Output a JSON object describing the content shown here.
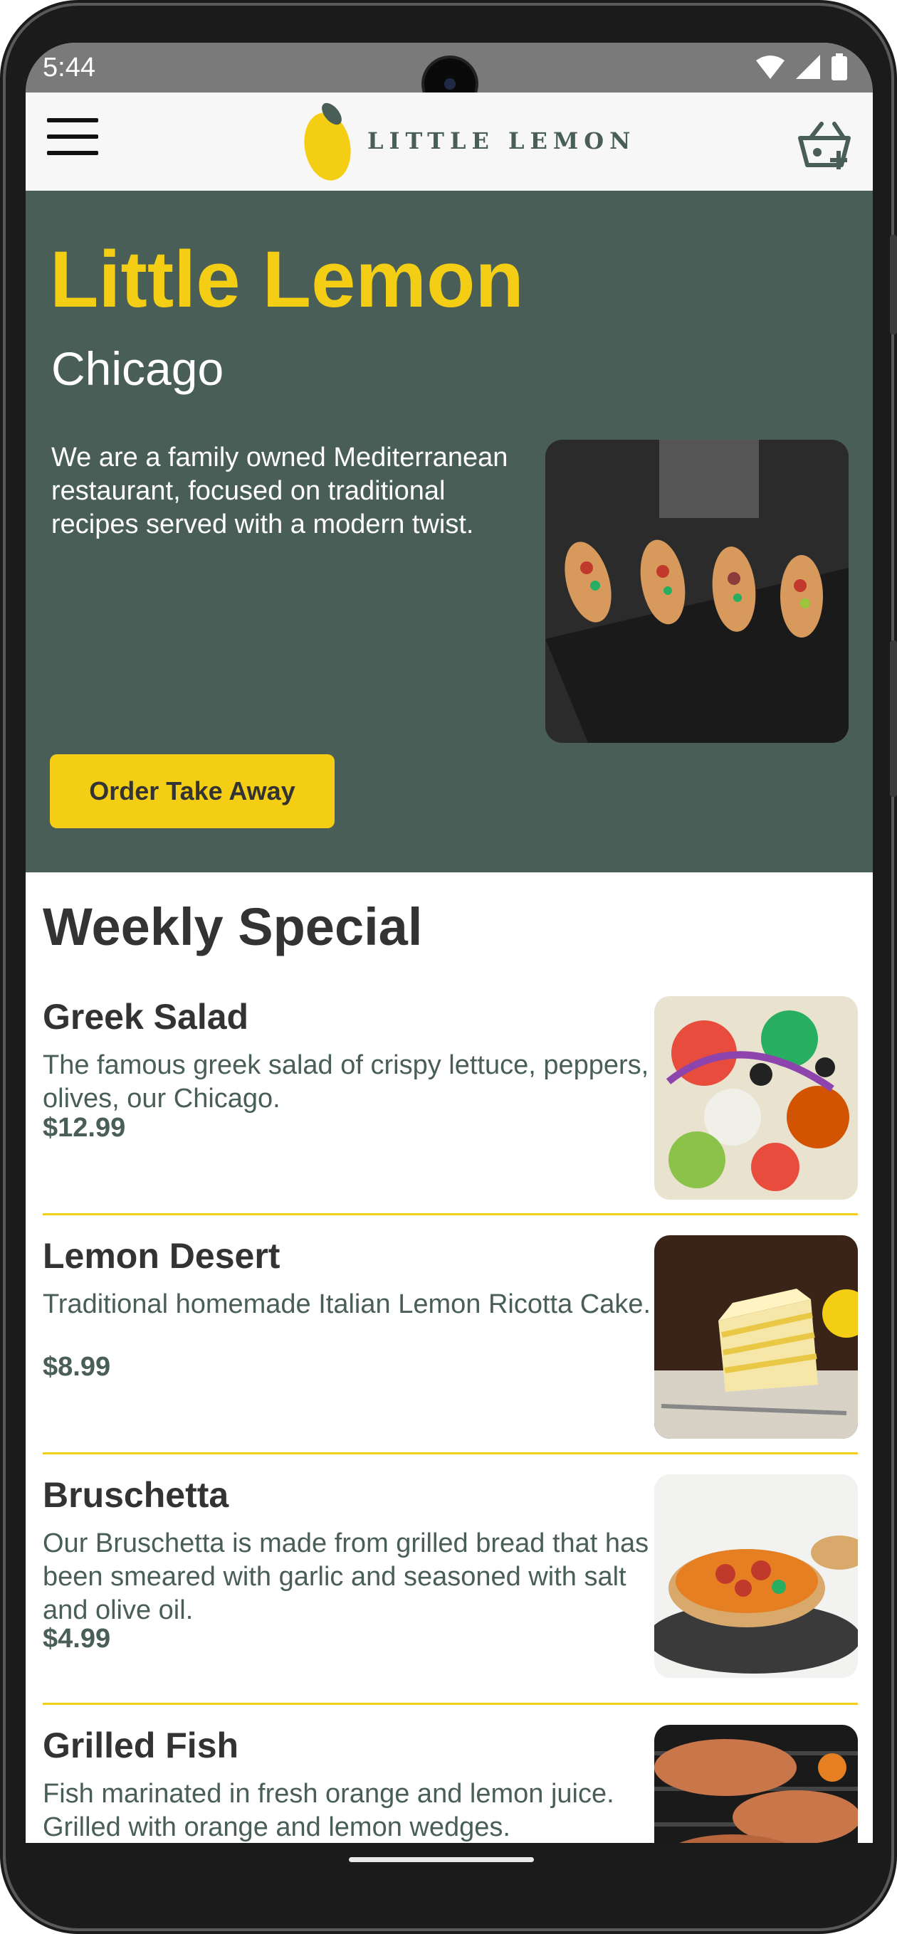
{
  "status": {
    "time": "5:44"
  },
  "app": {
    "logo_text": "LITTLE LEMON"
  },
  "hero": {
    "title": "Little Lemon",
    "city": "Chicago",
    "description": "We are a family owned Mediterranean restaurant, focused on traditional recipes served with a modern twist.",
    "button_label": "Order Take Away"
  },
  "weekly": {
    "title": "Weekly Special",
    "items": [
      {
        "name": "Greek Salad",
        "description": "The famous greek salad of crispy lettuce, peppers, olives, our Chicago.",
        "price": "$12.99"
      },
      {
        "name": "Lemon Desert",
        "description": "Traditional homemade Italian Lemon Ricotta Cake.",
        "price": "$8.99"
      },
      {
        "name": "Bruschetta",
        "description": "Our Bruschetta is made from grilled bread that has been smeared with garlic and seasoned with salt and olive oil.",
        "price": "$4.99"
      },
      {
        "name": "Grilled Fish",
        "description": "Fish marinated in fresh orange and lemon juice. Grilled with orange and lemon wedges.",
        "price": ""
      }
    ]
  },
  "colors": {
    "primary_green": "#495e57",
    "primary_yellow": "#f4ce14",
    "dark_text": "#333333"
  },
  "icons": [
    "menu-icon",
    "cart-icon",
    "wifi-icon",
    "signal-icon",
    "battery-icon"
  ]
}
